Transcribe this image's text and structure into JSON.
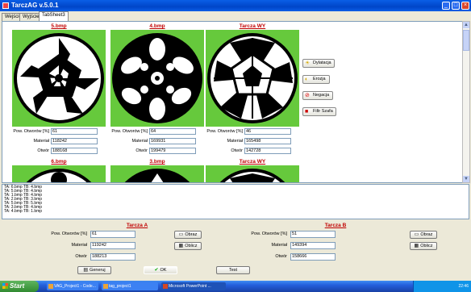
{
  "window": {
    "title": "TarczAG v.5.0.1"
  },
  "tabs": [
    "Wejście",
    "Wyjście",
    "TabSheet3"
  ],
  "panels_top": [
    {
      "title": "5.bmp",
      "pow_label": "Pow. Otworów [%]",
      "pow": "61",
      "mat_label": "Materiał",
      "mat": "118242",
      "otw_label": "Otwór",
      "otw": "188168"
    },
    {
      "title": "4.bmp",
      "pow_label": "Pow. Otworów [%]",
      "pow": "64",
      "mat_label": "Materiał",
      "mat": "169931",
      "otw_label": "Otwór",
      "otw": "199479"
    },
    {
      "title": "Tarcza WY",
      "pow_label": "Pow. Otworów [%]",
      "pow": "46",
      "mat_label": "Materiał",
      "mat": "165498",
      "otw_label": "Otwór",
      "otw": "142728"
    }
  ],
  "panels_bottom": [
    "6.bmp",
    "3.bmp",
    "Tarcza WY"
  ],
  "side_buttons": [
    {
      "label": "Dylatacja",
      "icon": "lightbulb-icon"
    },
    {
      "label": "Erozja",
      "icon": "sun-icon"
    },
    {
      "label": "Negacja",
      "icon": "no-entry-icon"
    },
    {
      "label": "Filtr Szafa",
      "icon": "filter-icon"
    }
  ],
  "log_lines": [
    "TA: 6.bmp TB: 4.bmp",
    "TA: 5.bmp TB: 4.bmp",
    "TA: 1.bmp TB: 4.bmp",
    "TA: 2.bmp TB: 3.bmp",
    "TA: 5.bmp TB: 5.bmp",
    "TA: 3.bmp TB: 4.bmp",
    "TA: 4.bmp TB: 1.bmp"
  ],
  "tarcza_a": {
    "title": "Tarcza A",
    "pow_label": "Pow. Otworów [%]",
    "pow": "61",
    "mat_label": "Materiał",
    "mat": "119242",
    "otw_label": "Otwór",
    "otw": "188213",
    "obraz": "Obraz",
    "oblicz": "Oblicz"
  },
  "tarcza_b": {
    "title": "Tarcza B",
    "pow_label": "Pow. Otworów [%]",
    "pow": "51",
    "mat_label": "Materiał",
    "mat": "149394",
    "otw_label": "Otwór",
    "otw": "158666",
    "obraz": "Obraz",
    "oblicz": "Oblicz"
  },
  "bottom_buttons": {
    "generate": "Generuj",
    "ok": "OK",
    "test": "Test"
  },
  "taskbar": {
    "start": "Start",
    "tasks": [
      "VAG_Project1 - Code...",
      "tag_project1",
      "Microsoft PowerPoint ..."
    ],
    "clock": "22:46"
  },
  "colors": {
    "panel_bg": "#66c93c",
    "title_red": "#c00000"
  }
}
